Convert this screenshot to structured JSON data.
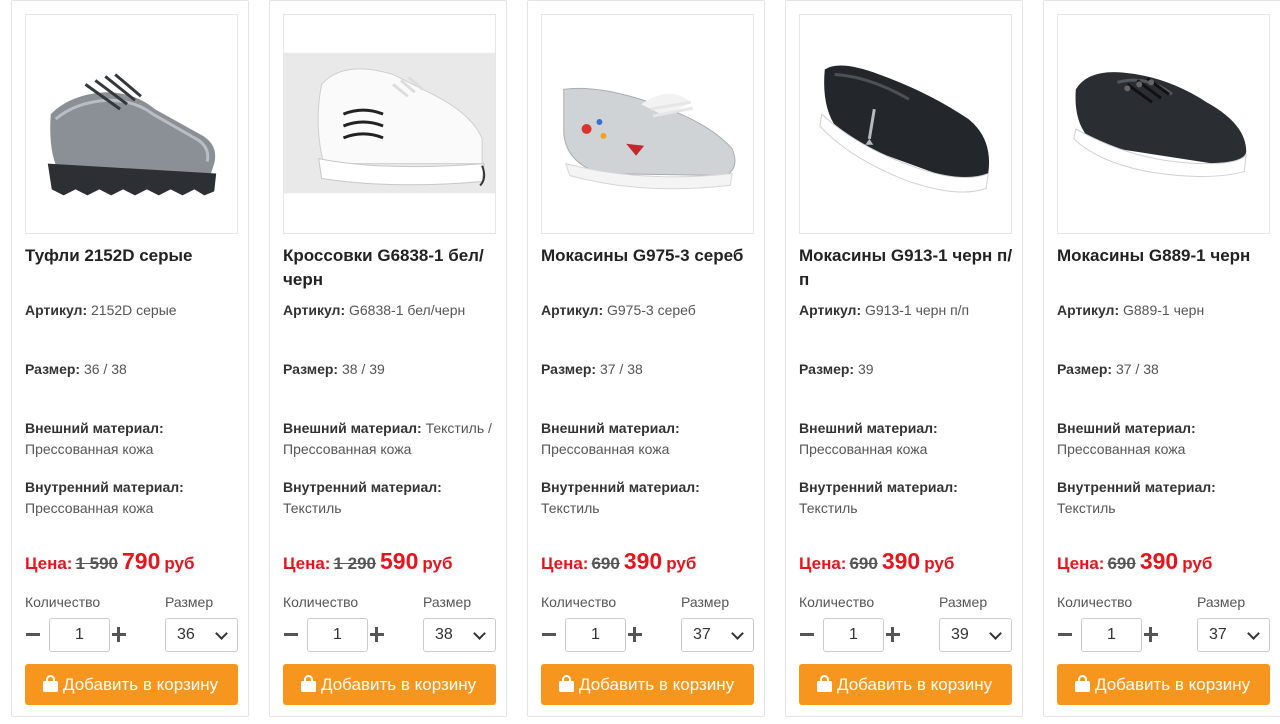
{
  "products": [
    {
      "image_icon": "grey-platform-lace-up-shoe-image",
      "title": "Туфли 2152D серые",
      "article_label": "Артикул:",
      "article": "2152D серые",
      "size_label": "Размер:",
      "sizes": "36 / 38",
      "outer_label": "Внешний материал:",
      "outer": "Прессованная кожа",
      "inner_label": "Внутренний материал:",
      "inner": "Прессованная кожа",
      "price_label": "Цена:",
      "old_price": "1 590",
      "new_price": "790",
      "currency": "руб",
      "qty_label": "Количество",
      "qty": "1",
      "size_select_label": "Размер",
      "selected_size": "36",
      "cart_label": "Добавить в корзину"
    },
    {
      "image_icon": "white-sneaker-image",
      "title": "Кроссовки G6838-1 бел/черн",
      "article_label": "Артикул:",
      "article": "G6838-1 бел/черн",
      "size_label": "Размер:",
      "sizes": "38 / 39",
      "outer_label": "Внешний материал:",
      "outer": "Текстиль / Прессованная кожа",
      "inner_label": "Внутренний материал:",
      "inner": "Текстиль",
      "price_label": "Цена:",
      "old_price": "1 290",
      "new_price": "590",
      "currency": "руб",
      "qty_label": "Количество",
      "qty": "1",
      "size_select_label": "Размер",
      "selected_size": "38",
      "cart_label": "Добавить в корзину"
    },
    {
      "image_icon": "silver-embroidered-moccasin-image",
      "title": "Мокасины G975-3 сереб",
      "article_label": "Артикул:",
      "article": "G975-3 сереб",
      "size_label": "Размер:",
      "sizes": "37 / 38",
      "outer_label": "Внешний материал:",
      "outer": "Прессованная кожа",
      "inner_label": "Внутренний материал:",
      "inner": "Текстиль",
      "price_label": "Цена:",
      "old_price": "690",
      "new_price": "390",
      "currency": "руб",
      "qty_label": "Количество",
      "qty": "1",
      "size_select_label": "Размер",
      "selected_size": "37",
      "cart_label": "Добавить в корзину"
    },
    {
      "image_icon": "black-slip-on-moccasin-image",
      "title": "Мокасины G913-1 черн п/п",
      "article_label": "Артикул:",
      "article": "G913-1 черн п/п",
      "size_label": "Размер:",
      "sizes": "39",
      "outer_label": "Внешний материал:",
      "outer": "Прессованная кожа",
      "inner_label": "Внутренний материал:",
      "inner": "Текстиль",
      "price_label": "Цена:",
      "old_price": "690",
      "new_price": "390",
      "currency": "руб",
      "qty_label": "Количество",
      "qty": "1",
      "size_select_label": "Размер",
      "selected_size": "39",
      "cart_label": "Добавить в корзину"
    },
    {
      "image_icon": "black-lace-up-moccasin-image",
      "title": "Мокасины G889-1 черн",
      "article_label": "Артикул:",
      "article": "G889-1 черн",
      "size_label": "Размер:",
      "sizes": "37 / 38",
      "outer_label": "Внешний материал:",
      "outer": "Прессованная кожа",
      "inner_label": "Внутренний материал:",
      "inner": "Текстиль",
      "price_label": "Цена:",
      "old_price": "690",
      "new_price": "390",
      "currency": "руб",
      "qty_label": "Количество",
      "qty": "1",
      "size_select_label": "Размер",
      "selected_size": "37",
      "cart_label": "Добавить в корзину"
    }
  ],
  "colors": {
    "accent_orange": "#f7961e",
    "price_red": "#e8141c",
    "border": "#e3e3e3"
  }
}
